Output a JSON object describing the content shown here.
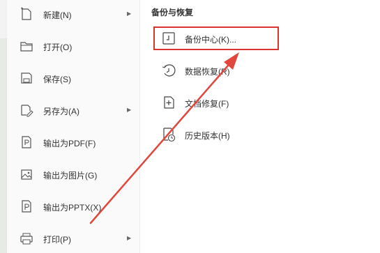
{
  "menu": {
    "items": [
      {
        "label": "新建(N)",
        "icon": "new-file-icon",
        "submenu": true
      },
      {
        "label": "打开(O)",
        "icon": "folder-icon",
        "submenu": false
      },
      {
        "label": "保存(S)",
        "icon": "save-icon",
        "submenu": false
      },
      {
        "label": "另存为(A)",
        "icon": "save-as-icon",
        "submenu": true
      },
      {
        "label": "输出为PDF(F)",
        "icon": "pdf-icon",
        "submenu": false
      },
      {
        "label": "输出为图片(G)",
        "icon": "image-icon",
        "submenu": false
      },
      {
        "label": "输出为PPTX(X)",
        "icon": "pptx-icon",
        "submenu": false
      },
      {
        "label": "打印(P)",
        "icon": "print-icon",
        "submenu": true
      }
    ],
    "arrow_glyph": "▶"
  },
  "backup_panel": {
    "title": "备份与恢复",
    "items": [
      {
        "label": "备份中心(K)...",
        "icon": "backup-center-icon"
      },
      {
        "label": "数据恢复(R)",
        "icon": "data-recovery-icon"
      },
      {
        "label": "文档修复(F)",
        "icon": "doc-repair-icon"
      },
      {
        "label": "历史版本(H)",
        "icon": "history-version-icon"
      }
    ]
  },
  "annotation": {
    "highlight_color": "#d9342b",
    "arrow_color": "#e0473d"
  }
}
